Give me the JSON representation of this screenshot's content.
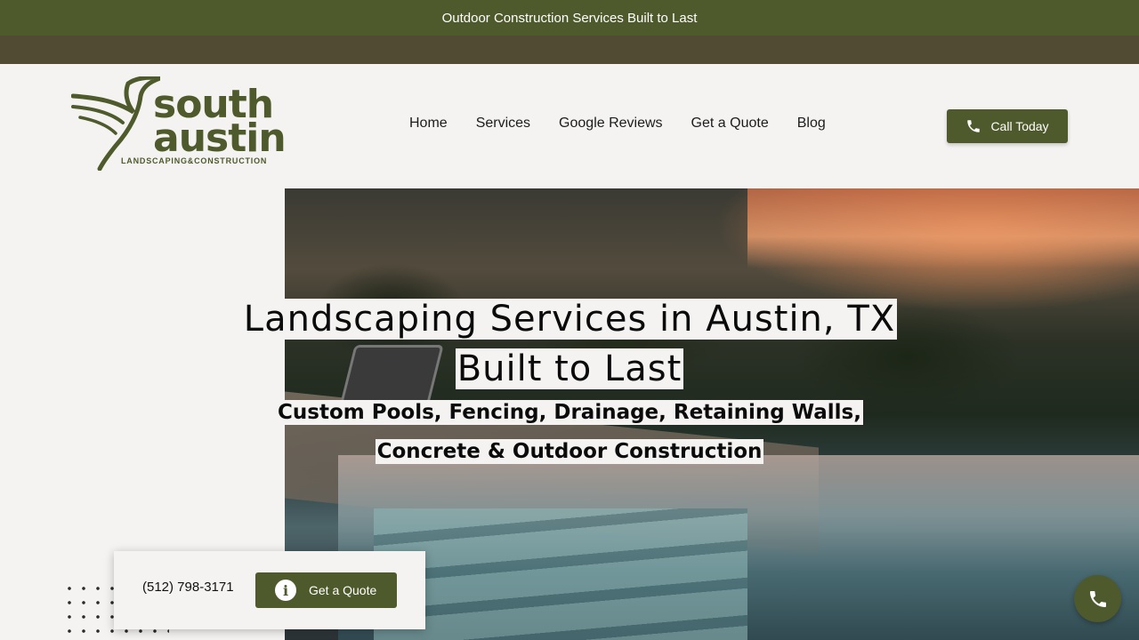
{
  "topbar": {
    "text": "Outdoor Construction Services Built to Last"
  },
  "logo": {
    "line1": "south",
    "line2": "austin",
    "tagline": "LANDSCAPING&CONSTRUCTION"
  },
  "nav": {
    "items": [
      {
        "label": "Home"
      },
      {
        "label": "Services"
      },
      {
        "label": "Google Reviews"
      },
      {
        "label": "Get a Quote"
      },
      {
        "label": "Blog"
      }
    ]
  },
  "header_cta": {
    "label": "Call Today",
    "icon": "phone-icon"
  },
  "hero": {
    "title_line1": "Landscaping Services in Austin, TX",
    "title_line2": "Built to Last",
    "subtitle_line1": "Custom Pools, Fencing, Drainage, Retaining Walls,",
    "subtitle_line2": "Concrete & Outdoor Construction"
  },
  "floating_bar": {
    "phone": "(512) 798-3171",
    "quote_label": "Get a Quote",
    "quote_icon": "info-icon"
  },
  "fab": {
    "icon": "phone-icon"
  },
  "colors": {
    "brand_green": "#4e5a2c",
    "subbar_brown": "#524b33",
    "background": "#f4f3f1"
  }
}
